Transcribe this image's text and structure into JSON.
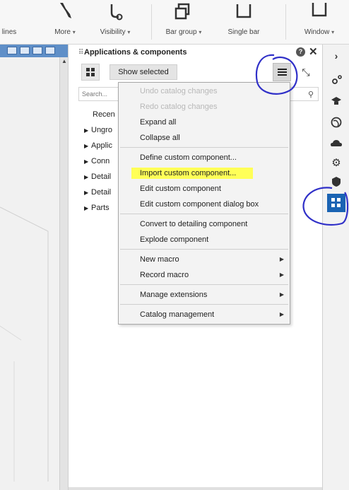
{
  "ribbon": {
    "items": [
      {
        "label": "lines",
        "icon": "lines-icon"
      },
      {
        "label": "More",
        "icon": "wrench-icon"
      },
      {
        "label": "Visibility",
        "icon": "visibility-icon"
      },
      {
        "label": "Bar group",
        "icon": "bar-group-icon"
      },
      {
        "label": "Single bar",
        "icon": "single-bar-icon"
      },
      {
        "label": "Window",
        "icon": "window-icon"
      }
    ]
  },
  "panel": {
    "title": "Applications & components",
    "show_selected_label": "Show selected",
    "search_placeholder": "Search..."
  },
  "tree": {
    "items": [
      {
        "label": "Recen",
        "expandable": false
      },
      {
        "label": "Ungro",
        "expandable": true
      },
      {
        "label": "Applic",
        "expandable": true
      },
      {
        "label": "Conn",
        "expandable": true
      },
      {
        "label": "Detail",
        "expandable": true
      },
      {
        "label": "Detail",
        "expandable": true
      },
      {
        "label": "Parts",
        "expandable": true
      }
    ]
  },
  "menu": {
    "items": [
      {
        "label": "Undo catalog changes",
        "disabled": true,
        "submenu": false
      },
      {
        "label": "Redo catalog changes",
        "disabled": true,
        "submenu": false
      },
      {
        "label": "Expand all",
        "disabled": false,
        "submenu": false
      },
      {
        "label": "Collapse all",
        "disabled": false,
        "submenu": false
      },
      {
        "label": "Define custom component...",
        "disabled": false,
        "submenu": false
      },
      {
        "label": "Import custom component...",
        "disabled": false,
        "submenu": false,
        "highlighted": true
      },
      {
        "label": "Edit custom component",
        "disabled": false,
        "submenu": false
      },
      {
        "label": "Edit custom component dialog box",
        "disabled": false,
        "submenu": false
      },
      {
        "label": "Convert to detailing component",
        "disabled": false,
        "submenu": false
      },
      {
        "label": "Explode component",
        "disabled": false,
        "submenu": false
      },
      {
        "label": "New macro",
        "disabled": false,
        "submenu": true
      },
      {
        "label": "Record macro",
        "disabled": false,
        "submenu": true
      },
      {
        "label": "Manage extensions",
        "disabled": false,
        "submenu": true
      },
      {
        "label": "Catalog management",
        "disabled": false,
        "submenu": true
      }
    ],
    "highlight_color": "#ffff57"
  },
  "rightbar": {
    "icons": [
      "chevron-right-icon",
      "settings-dots-icon",
      "cap-icon",
      "globe-icon",
      "cloud-icon",
      "gear-icon",
      "shield-icon",
      "applications-components-icon"
    ],
    "active": "applications-components-icon",
    "accent": "#1a63b3"
  },
  "annotation_color": "#3030c8"
}
